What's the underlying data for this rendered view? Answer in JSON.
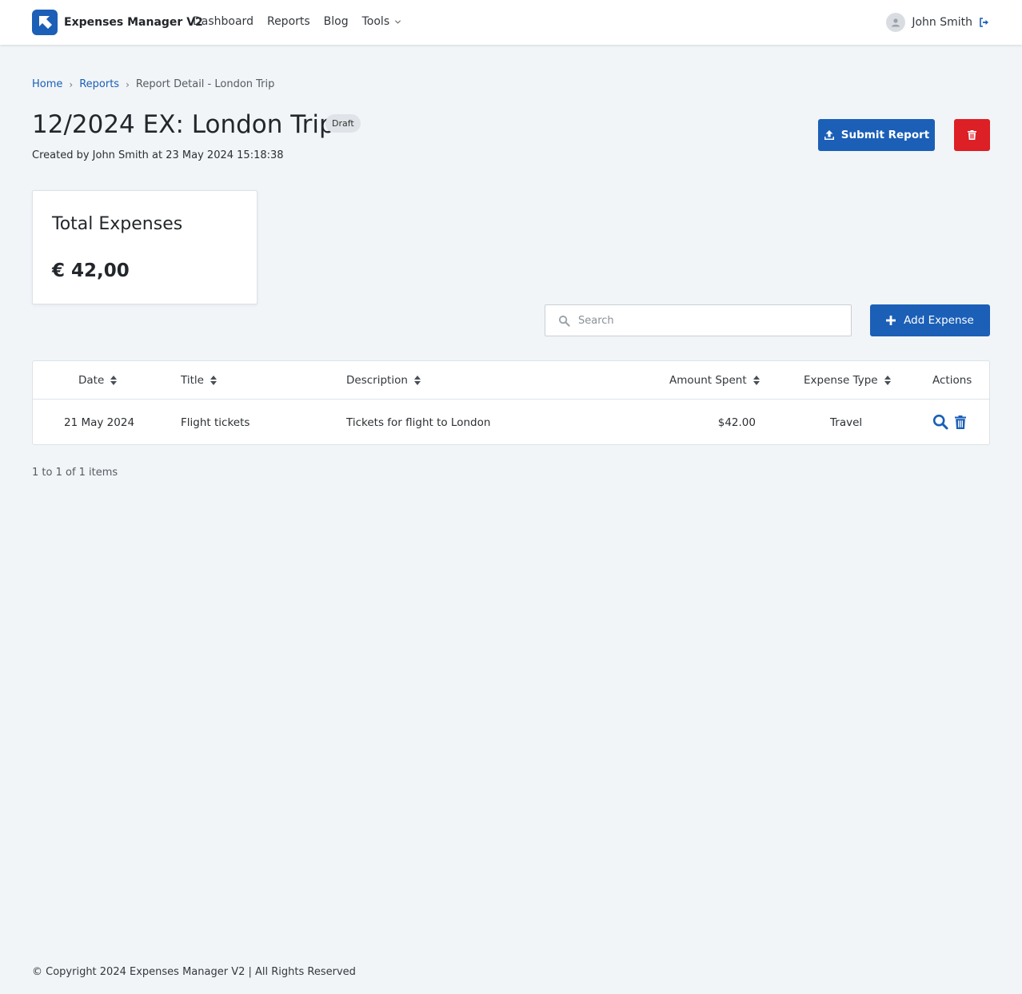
{
  "app": {
    "name": "Expenses Manager V2"
  },
  "nav": {
    "items": [
      {
        "label": "Dashboard"
      },
      {
        "label": "Reports"
      },
      {
        "label": "Blog"
      }
    ],
    "tools_label": "Tools",
    "user_name": "John Smith"
  },
  "breadcrumb": {
    "home": "Home",
    "reports": "Reports",
    "current": "Report Detail - London Trip",
    "separator": "›"
  },
  "report": {
    "title": "12/2024 EX: London Trip",
    "status": "Draft",
    "created_by": "Created by John Smith at 23 May 2024 15:18:38"
  },
  "actions": {
    "submit_label": "Submit Report",
    "add_expense_label": "Add Expense"
  },
  "summary": {
    "label": "Total Expenses",
    "value": "€ 42,00"
  },
  "search": {
    "placeholder": "Search",
    "value": ""
  },
  "table": {
    "columns": [
      {
        "label": "Date"
      },
      {
        "label": "Title"
      },
      {
        "label": "Description"
      },
      {
        "label": "Amount Spent"
      },
      {
        "label": "Expense Type"
      },
      {
        "label": "Actions"
      }
    ],
    "rows": [
      {
        "date": "21 May 2024",
        "title": "Flight tickets",
        "description": "Tickets for flight to London",
        "amount": "$42.00",
        "type": "Travel"
      }
    ]
  },
  "pagination": {
    "summary": "1 to 1 of 1 items"
  },
  "footer": {
    "text": "© Copyright 2024 Expenses Manager V2 | All Rights Reserved"
  },
  "colors": {
    "primary": "#1b5fb7",
    "danger": "#dd1f26",
    "background": "#f1f5f8",
    "link": "#1a5fb4"
  },
  "icons": {
    "logo": "app-logo-icon",
    "tools_dropdown": "chevron-down-icon",
    "avatar": "user-avatar-icon",
    "logout": "logout-icon",
    "submit": "upload-icon",
    "delete_report": "trash-icon",
    "search": "search-icon",
    "add": "plus-icon",
    "sort": "sort-icon",
    "view_row": "search-icon",
    "delete_row": "trash-icon"
  }
}
